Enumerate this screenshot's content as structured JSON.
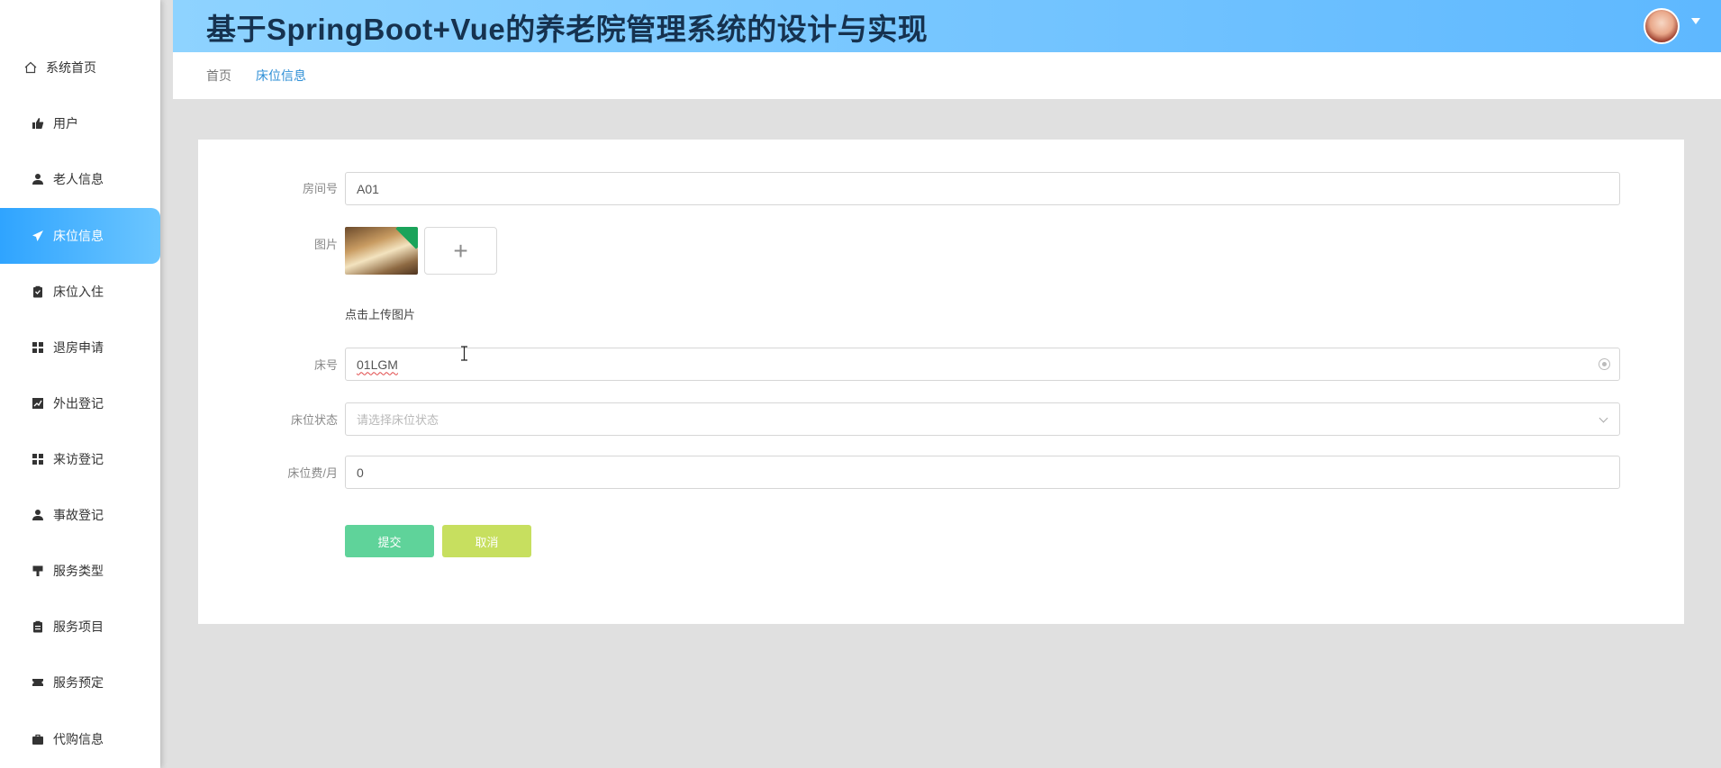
{
  "header": {
    "title": "基于SpringBoot+Vue的养老院管理系统的设计与实现"
  },
  "sidebar": {
    "items": [
      {
        "label": "系统首页",
        "icon": "home-icon"
      },
      {
        "label": "用户",
        "icon": "thumbs-up-icon"
      },
      {
        "label": "老人信息",
        "icon": "person-icon"
      },
      {
        "label": "床位信息",
        "icon": "paper-plane-icon",
        "active": true
      },
      {
        "label": "床位入住",
        "icon": "clipboard-icon"
      },
      {
        "label": "退房申请",
        "icon": "grid-icon"
      },
      {
        "label": "外出登记",
        "icon": "chart-icon"
      },
      {
        "label": "来访登记",
        "icon": "grid-icon"
      },
      {
        "label": "事故登记",
        "icon": "person-icon"
      },
      {
        "label": "服务类型",
        "icon": "flag-icon"
      },
      {
        "label": "服务项目",
        "icon": "clipboard-icon"
      },
      {
        "label": "服务预定",
        "icon": "ticket-icon"
      },
      {
        "label": "代购信息",
        "icon": "briefcase-icon"
      }
    ]
  },
  "breadcrumb": {
    "home": "首页",
    "current": "床位信息"
  },
  "form": {
    "room_number": {
      "label": "房间号",
      "value": "A01"
    },
    "image": {
      "label": "图片",
      "upload_hint": "点击上传图片",
      "upload_symbol": "+"
    },
    "bed_number": {
      "label": "床号",
      "value": "01LGM"
    },
    "bed_status": {
      "label": "床位状态",
      "placeholder": "请选择床位状态"
    },
    "bed_fee": {
      "label": "床位费/月",
      "value": "0"
    },
    "submit_label": "提交",
    "cancel_label": "取消"
  },
  "colors": {
    "accent": "#2fa4ff",
    "submit": "#5fd39a",
    "cancel": "#c7df5f",
    "header_text": "#16324f"
  }
}
